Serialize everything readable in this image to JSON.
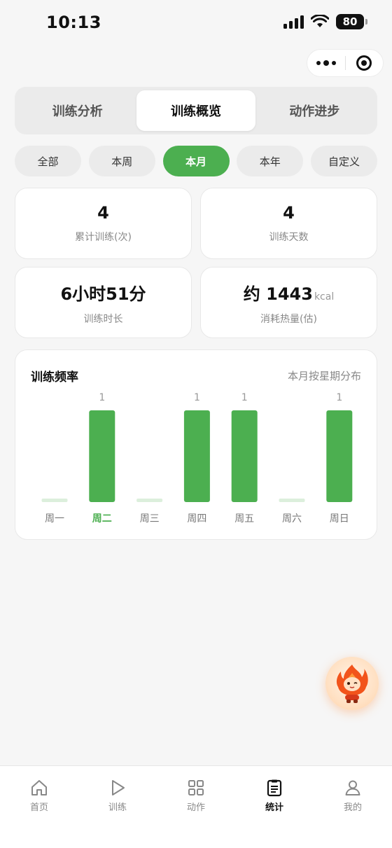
{
  "status_bar": {
    "time": "10:13",
    "battery": "80"
  },
  "tabs": [
    {
      "label": "训练分析",
      "active": false
    },
    {
      "label": "训练概览",
      "active": true
    },
    {
      "label": "动作进步",
      "active": false
    }
  ],
  "periods": [
    {
      "label": "全部",
      "active": false
    },
    {
      "label": "本周",
      "active": false
    },
    {
      "label": "本月",
      "active": true
    },
    {
      "label": "本年",
      "active": false
    },
    {
      "label": "自定义",
      "active": false
    }
  ],
  "stats": {
    "sessions": {
      "value": "4",
      "label": "累计训练(次)"
    },
    "days": {
      "value": "4",
      "label": "训练天数"
    },
    "duration": {
      "value": "6小时51分",
      "label": "训练时长"
    },
    "calories": {
      "value": "约 1443",
      "unit": "kcal",
      "label": "消耗热量(估)"
    }
  },
  "frequency": {
    "title": "训练频率",
    "subtitle": "本月按星期分布"
  },
  "chart_data": {
    "type": "bar",
    "categories": [
      "周一",
      "周二",
      "周三",
      "周四",
      "周五",
      "周六",
      "周日"
    ],
    "values": [
      0,
      1,
      0,
      1,
      1,
      0,
      1
    ],
    "highlight_category": "周二",
    "ylim": [
      0,
      1
    ],
    "grid": false,
    "colors": {
      "bar": "#4caf50",
      "empty_bar": "#dcefdc",
      "highlight_label": "#4caf50"
    }
  },
  "nav": [
    {
      "label": "首页",
      "icon": "home-icon",
      "active": false
    },
    {
      "label": "训练",
      "icon": "play-icon",
      "active": false
    },
    {
      "label": "动作",
      "icon": "grid-icon",
      "active": false
    },
    {
      "label": "统计",
      "icon": "clipboard-icon",
      "active": true
    },
    {
      "label": "我的",
      "icon": "user-icon",
      "active": false
    }
  ],
  "colors": {
    "accent": "#4caf50",
    "background": "#f6f6f6"
  }
}
